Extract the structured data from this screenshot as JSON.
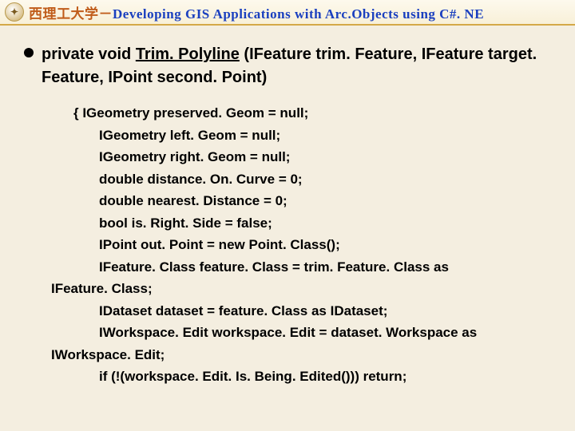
{
  "header": {
    "logo_glyph": "✦",
    "cn_text": "西理工大学－",
    "en_text": "Developing GIS Applications with Arc.Objects using C#. NE"
  },
  "signature": {
    "keyword_mods": "private void ",
    "method_name": "Trim. Polyline",
    "params": " (IFeature trim. Feature, IFeature target. Feature, IPoint second. Point)"
  },
  "code": {
    "lines": [
      {
        "cls": "brace",
        "text": "{   IGeometry preserved. Geom = null;"
      },
      {
        "cls": "ind1",
        "text": "IGeometry left. Geom = null;"
      },
      {
        "cls": "ind1",
        "text": "IGeometry right. Geom = null;"
      },
      {
        "cls": "ind1",
        "text": "double distance. On. Curve = 0;"
      },
      {
        "cls": "ind1",
        "text": "double nearest. Distance = 0;"
      },
      {
        "cls": "ind1",
        "text": "bool is. Right. Side = false;"
      },
      {
        "cls": "ind1",
        "text": "IPoint out. Point = new Point. Class();"
      },
      {
        "cls": "ind1",
        "text": "IFeature. Class feature. Class = trim. Feature. Class as"
      },
      {
        "cls": "ind0",
        "text": "IFeature. Class;"
      },
      {
        "cls": "ind1",
        "text": "IDataset dataset = feature. Class as IDataset;"
      },
      {
        "cls": "ind1",
        "text": "IWorkspace. Edit workspace. Edit = dataset. Workspace as"
      },
      {
        "cls": "ind0",
        "text": "IWorkspace. Edit;"
      },
      {
        "cls": "ind1",
        "text": "if (!(workspace. Edit. Is. Being. Edited())) return;"
      }
    ]
  }
}
